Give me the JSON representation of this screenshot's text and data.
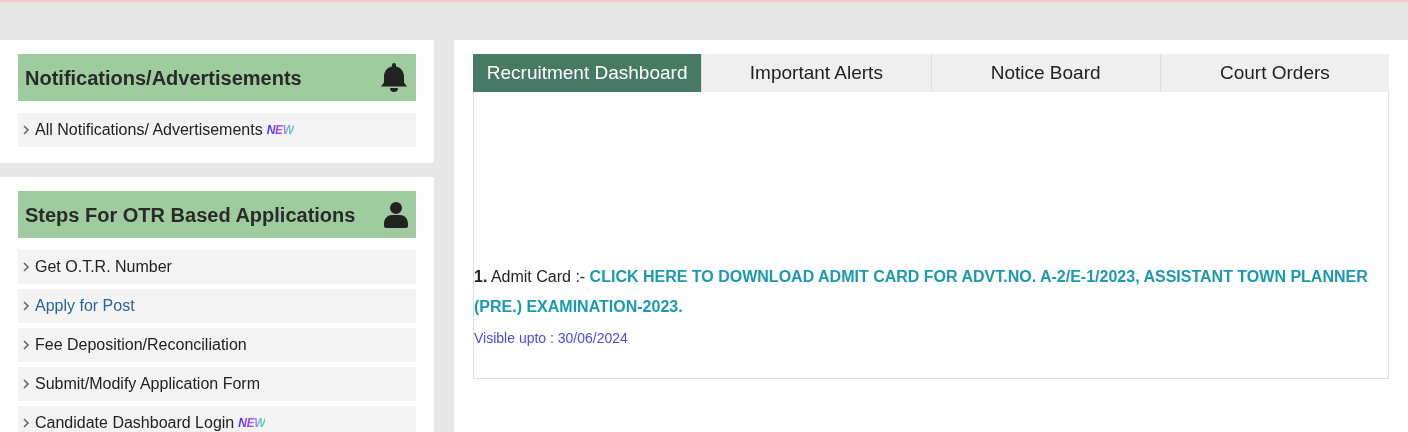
{
  "sidebar": {
    "sections": [
      {
        "title": "Notifications/Advertisements",
        "kind": "bell",
        "items": [
          {
            "label": "All Notifications/ Advertisements",
            "badge": "NEW",
            "color": "#222222"
          }
        ]
      },
      {
        "title": "Steps For OTR Based Applications",
        "kind": "user",
        "items": [
          {
            "label": "Get O.T.R. Number",
            "color": "#222222"
          },
          {
            "label": "Apply for Post",
            "color": "#2a6496"
          },
          {
            "label": "Fee Deposition/Reconciliation",
            "color": "#222222"
          },
          {
            "label": "Submit/Modify Application Form",
            "color": "#222222"
          },
          {
            "label": "Candidate Dashboard Login",
            "badge": "NEW",
            "color": "#222222"
          }
        ]
      }
    ]
  },
  "tabs": [
    {
      "label": "Recruitment Dashboard",
      "selected": true
    },
    {
      "label": "Important Alerts",
      "selected": false
    },
    {
      "label": "Notice Board",
      "selected": false
    },
    {
      "label": "Court Orders",
      "selected": false
    }
  ],
  "notices": [
    {
      "number": "1.",
      "type": "Admit Card :-",
      "link": "CLICK HERE TO DOWNLOAD ADMIT CARD FOR ADVT.NO. A-2/E-1/2023, ASSISTANT TOWN PLANNER (PRE.) EXAMINATION-2023.",
      "visible": "Visible upto : 30/06/2024"
    }
  ]
}
